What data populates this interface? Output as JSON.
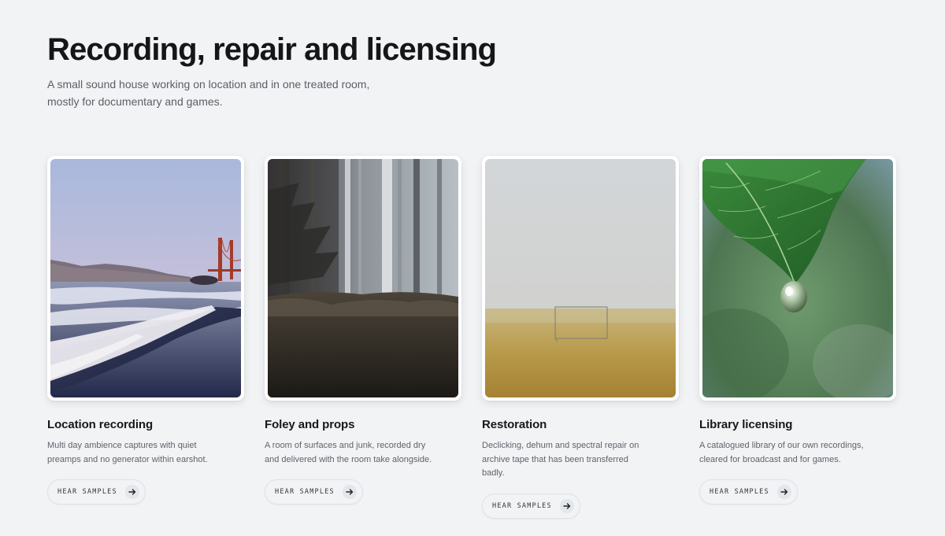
{
  "hero": {
    "title": "Recording, repair and licensing",
    "subtitle": "A small sound house working on location and in one treated room, mostly for documentary and games."
  },
  "cards": [
    {
      "title": "Location recording",
      "description": "Multi day ambience captures with quiet preamps and no generator within earshot.",
      "button_label": "HEAR SAMPLES",
      "image": "bay-bridge-coast-photo"
    },
    {
      "title": "Foley and props",
      "description": "A room of surfaces and junk, recorded dry and delivered with the room take alongside.",
      "button_label": "HEAR SAMPLES",
      "image": "misty-forest-photo"
    },
    {
      "title": "Restoration",
      "description": "Declicking, dehum and spectral repair on archive tape that has been transferred badly.",
      "button_label": "HEAR SAMPLES",
      "image": "foggy-field-goal-photo"
    },
    {
      "title": "Library licensing",
      "description": "A catalogued library of our own recordings, cleared for broadcast and for games.",
      "button_label": "HEAR SAMPLES",
      "image": "leaf-water-drop-photo"
    }
  ],
  "icons": {
    "button_arrow": "arrow-right-icon"
  },
  "colors": {
    "background": "#f1f3f5",
    "text": "#141618",
    "muted": "#5f646b"
  }
}
